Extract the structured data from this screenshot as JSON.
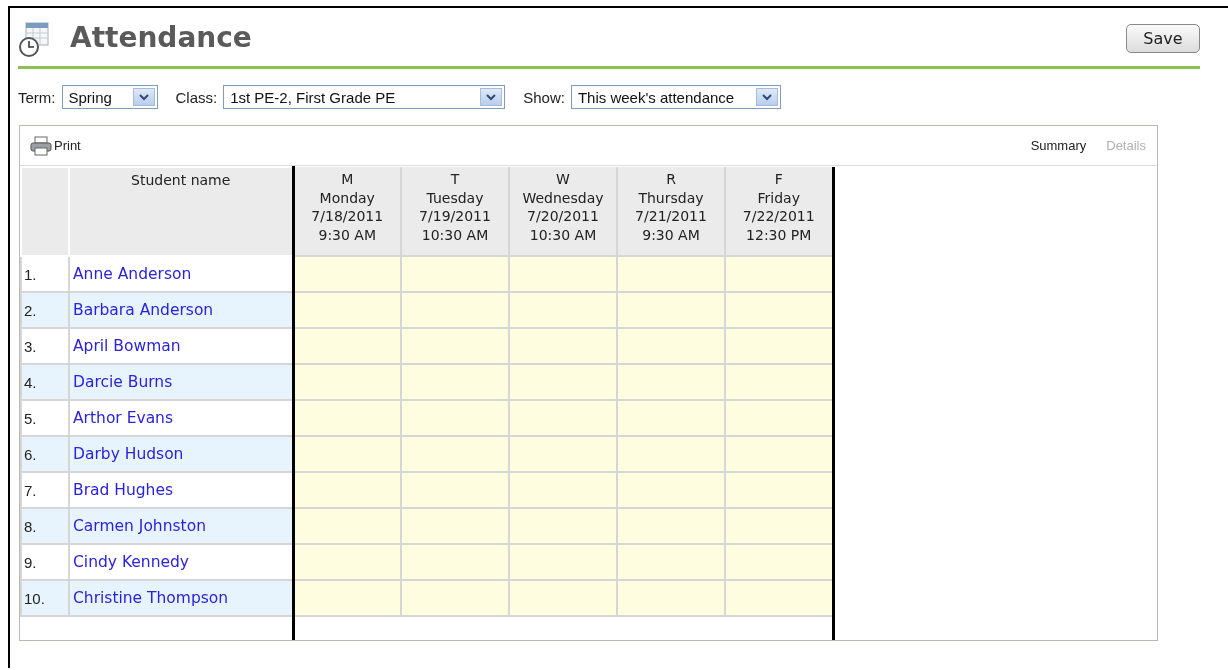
{
  "header": {
    "title": "Attendance",
    "save_button": "Save"
  },
  "filters": [
    {
      "label": "Term:",
      "value": "Spring",
      "kind": "short"
    },
    {
      "label": "Class:",
      "value": "1st PE-2, First Grade PE",
      "kind": "long"
    },
    {
      "label": "Show:",
      "value": "This week's attendance",
      "kind": "medium"
    }
  ],
  "toolbar": {
    "print": "Print",
    "views": [
      {
        "label": "Summary",
        "selected": true
      },
      {
        "label": "Details",
        "selected": false
      }
    ]
  },
  "table": {
    "name_column": "Student name",
    "days": [
      {
        "letter": "M",
        "day": "Monday",
        "date": "7/18/2011",
        "time": "9:30 AM"
      },
      {
        "letter": "T",
        "day": "Tuesday",
        "date": "7/19/2011",
        "time": "10:30 AM"
      },
      {
        "letter": "W",
        "day": "Wednesday",
        "date": "7/20/2011",
        "time": "10:30 AM"
      },
      {
        "letter": "R",
        "day": "Thursday",
        "date": "7/21/2011",
        "time": "9:30 AM"
      },
      {
        "letter": "F",
        "day": "Friday",
        "date": "7/22/2011",
        "time": "12:30 PM"
      }
    ],
    "rows": [
      {
        "number": "1.",
        "name": "Anne Anderson"
      },
      {
        "number": "2.",
        "name": "Barbara Anderson"
      },
      {
        "number": "3.",
        "name": "April Bowman"
      },
      {
        "number": "4.",
        "name": "Darcie Burns"
      },
      {
        "number": "5.",
        "name": "Arthor Evans"
      },
      {
        "number": "6.",
        "name": "Darby Hudson"
      },
      {
        "number": "7.",
        "name": "Brad Hughes"
      },
      {
        "number": "8.",
        "name": "Carmen Johnston"
      },
      {
        "number": "9.",
        "name": "Cindy Kennedy"
      },
      {
        "number": "10.",
        "name": "Christine Thompson"
      }
    ]
  }
}
